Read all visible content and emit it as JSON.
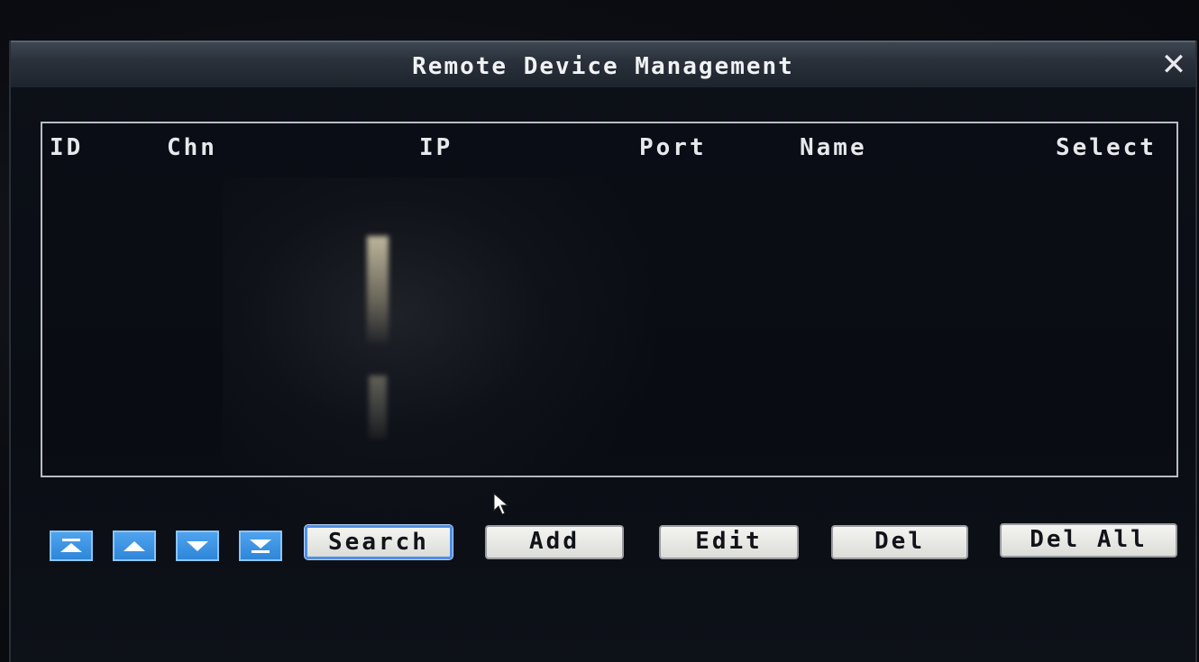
{
  "window": {
    "title": "Remote Device Management",
    "close_icon": "close-icon"
  },
  "table": {
    "columns": [
      "ID",
      "Chn",
      "IP",
      "Port",
      "Name",
      "Select"
    ],
    "rows": []
  },
  "toolbar": {
    "nav_buttons": [
      "first-page-icon",
      "prev-page-icon",
      "next-page-icon",
      "last-page-icon"
    ],
    "search_label": "Search",
    "add_label": "Add",
    "edit_label": "Edit",
    "del_label": "Del",
    "del_all_label": "Del All"
  },
  "colors": {
    "nav_button": "#2f86d8",
    "selected_button_border": "#4f8fe6",
    "button_face": "#e8e8e4"
  }
}
